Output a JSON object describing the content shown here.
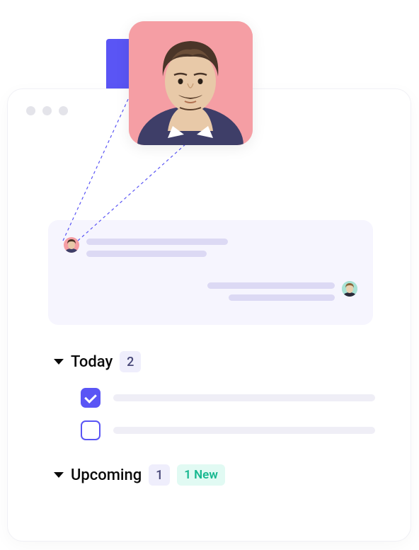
{
  "accent_color": "#5A55F5",
  "sections": {
    "today": {
      "label": "Today",
      "count": "2",
      "tasks": [
        {
          "checked": true
        },
        {
          "checked": false
        }
      ]
    },
    "upcoming": {
      "label": "Upcoming",
      "count": "1",
      "new_badge": "1 New"
    }
  },
  "chat": {
    "avatars": {
      "sender": "user-pink",
      "recipient": "user-teal"
    }
  }
}
